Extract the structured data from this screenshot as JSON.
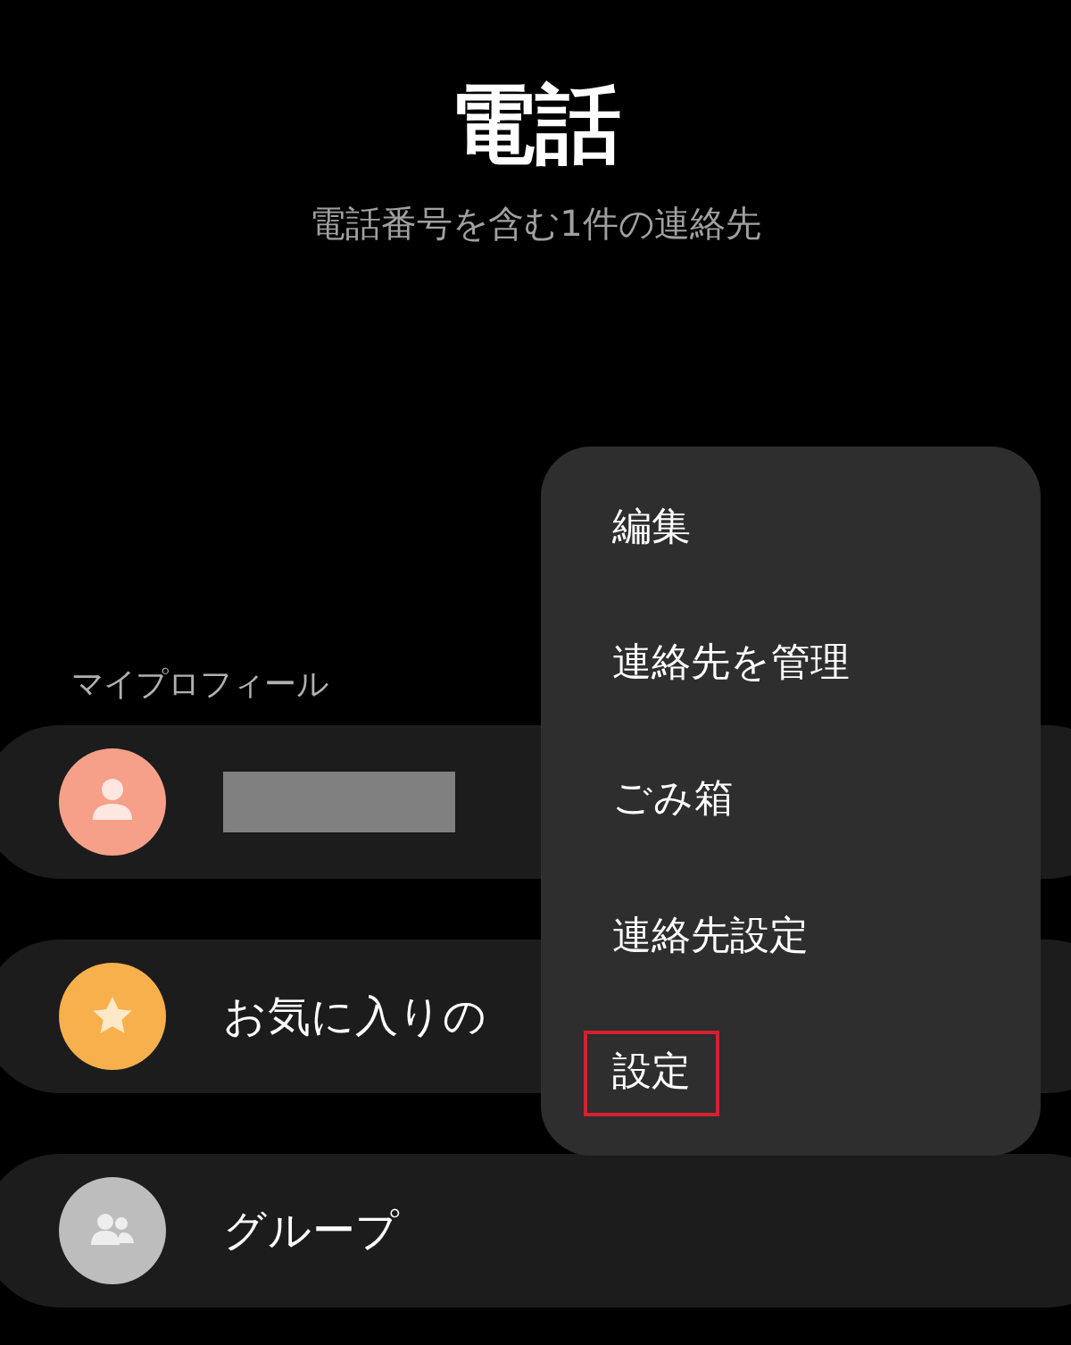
{
  "header": {
    "title": "電話",
    "subtitle": "電話番号を含む1件の連絡先"
  },
  "section_label": "マイプロフィール",
  "rows": [
    {
      "kind": "profile",
      "label": ""
    },
    {
      "kind": "favorites",
      "label": "お気に入りの"
    },
    {
      "kind": "groups",
      "label": "グループ"
    }
  ],
  "menu": {
    "items": [
      {
        "label": "編集",
        "highlighted": false
      },
      {
        "label": "連絡先を管理",
        "highlighted": false
      },
      {
        "label": "ごみ箱",
        "highlighted": false
      },
      {
        "label": "連絡先設定",
        "highlighted": false
      },
      {
        "label": "設定",
        "highlighted": true
      }
    ]
  }
}
